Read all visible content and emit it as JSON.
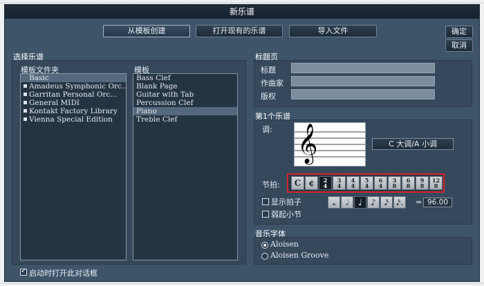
{
  "dialog": {
    "title": "新乐谱",
    "buttons": {
      "from_template": "从模板创建",
      "open_existing": "打开现有的乐谱",
      "import_file": "导入文件",
      "ok": "确定",
      "cancel": "取消"
    }
  },
  "choose_score": {
    "section_title": "选择乐谱",
    "folders_title": "模板文件夹",
    "folders": [
      "Basic",
      "Amadeus Symphonic Orc...",
      "Garritan Personal Orc...",
      "General MIDI",
      "Kontakt Factory Library",
      "Vienna Special Edition"
    ],
    "selected_folder": "Basic",
    "templates_title": "模板",
    "templates": [
      "Bass Clef",
      "Blank Page",
      "Guitar with Tab",
      "Percussion Clef",
      "Piano",
      "Treble Clef"
    ],
    "selected_template": "Piano"
  },
  "title_page": {
    "section_title": "标题页",
    "fields": [
      {
        "label": "标题",
        "value": ""
      },
      {
        "label": "作曲家",
        "value": ""
      },
      {
        "label": "版权",
        "value": ""
      }
    ]
  },
  "first_staff": {
    "section_title": "第1个乐谱",
    "key_label": "调:",
    "key_value": "C 大调/A 小调",
    "clef_glyph": "𝄞",
    "meter_label": "节拍:",
    "meters": [
      {
        "top": "C",
        "bottom": ""
      },
      {
        "top": "¢",
        "bottom": ""
      },
      {
        "top": "2",
        "bottom": "4"
      },
      {
        "top": "3",
        "bottom": "4"
      },
      {
        "top": "4",
        "bottom": "4"
      },
      {
        "top": "5",
        "bottom": "4"
      },
      {
        "top": "6",
        "bottom": "4"
      },
      {
        "top": "3",
        "bottom": "8"
      },
      {
        "top": "6",
        "bottom": "8"
      },
      {
        "top": "9",
        "bottom": "8"
      },
      {
        "top": "12",
        "bottom": "8"
      }
    ],
    "selected_meter_index": 2,
    "show_pickup_label": "显示拍子",
    "show_pickup_checked": false,
    "anacrusis_label": "弱起小节",
    "anacrusis_checked": false,
    "note_values": [
      "𝅝",
      "𝅗𝅥",
      "♩",
      "♪",
      "𝅘𝅥𝅯",
      "𝅘𝅥𝅯."
    ],
    "selected_note_index": 2,
    "equals": "=",
    "tempo": "96.00"
  },
  "music_font": {
    "section_title": "音乐字体",
    "options": [
      "Aloisen",
      "Aloisen Groove"
    ],
    "selected": "Aloisen"
  },
  "footer": {
    "show_on_startup_label": "启动时打开此对话框",
    "show_on_startup_checked": true
  }
}
